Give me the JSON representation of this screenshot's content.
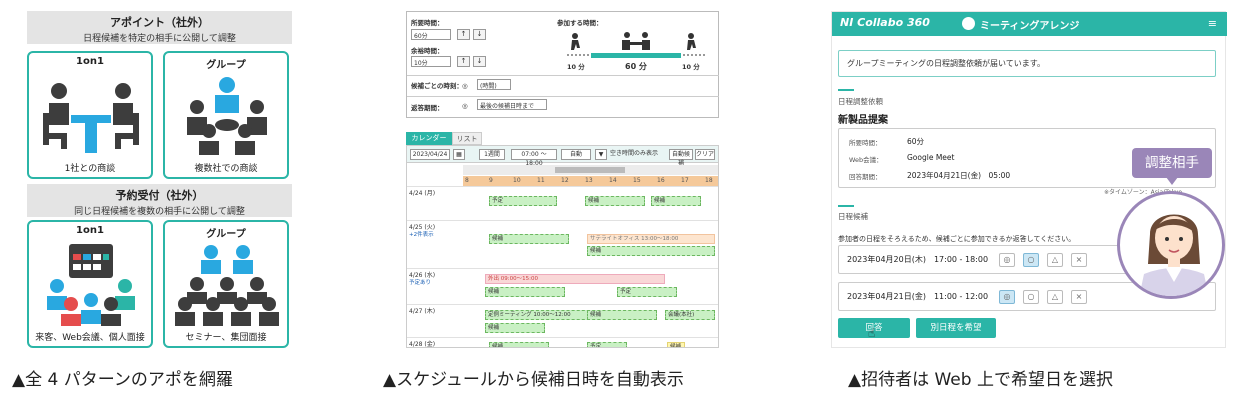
{
  "panel1": {
    "section_appointment": {
      "title": "アポイント（社外）",
      "subtitle": "日程候補を特定の相手に公開して調整"
    },
    "section_reservation": {
      "title": "予約受付（社外）",
      "subtitle": "同じ日程候補を複数の相手に公開して調整"
    },
    "cards": [
      {
        "title": "1on1",
        "caption": "1社との商談",
        "icon": "one-on-one-meeting-icon"
      },
      {
        "title": "グループ",
        "caption": "複数社での商談",
        "icon": "group-meeting-icon"
      },
      {
        "title": "1on1",
        "caption": "来客、Web会議、個人面接",
        "icon": "calendar-booking-icon"
      },
      {
        "title": "グループ",
        "caption": "セミナー、集団面接",
        "icon": "seminar-icon"
      }
    ],
    "colors": {
      "accent": "#2bb5a7",
      "figure": "#3d3d3d",
      "table": "#29a8e0"
    }
  },
  "panel2": {
    "form": {
      "required_time_label": "所要時間：",
      "required_time_value": "60分",
      "buffer_label": "余裕時間：",
      "buffer_value": "10分",
      "participants_label": "参加する時間：",
      "timeline_left": "10 分",
      "timeline_center": "60 分",
      "timeline_right": "10 分",
      "per_candidate_label": "候補ごとの時刻：",
      "per_candidate_value": "(時間)",
      "deadline_label": "返答期間：",
      "deadline_value": "最後の候補日時まで"
    },
    "tabs": [
      "カレンダー",
      "リスト"
    ],
    "toolbar": {
      "date": "2023/04/24",
      "range": "1週間",
      "time": "07:00 ～ 18:00",
      "autofill": "自動",
      "checkbox": "空き時間のみ表示",
      "btn_auto": "自動候補",
      "btn_clear": "クリア"
    },
    "hours": [
      "8",
      "9",
      "10",
      "11",
      "12",
      "13",
      "14",
      "15",
      "16",
      "17",
      "18"
    ],
    "days": [
      {
        "label": "4/24 (月)",
        "sub": ""
      },
      {
        "label": "4/25 (火)",
        "sub": "+2件表示"
      },
      {
        "label": "4/26 (水)",
        "sub": "予定あり"
      },
      {
        "label": "4/27 (木)",
        "sub": ""
      },
      {
        "label": "4/28 (金)",
        "sub": ""
      }
    ],
    "event_texts": {
      "candidate": "候補",
      "busy": "予定",
      "satellite": "サテライトオフィス 13:00～18:00",
      "outing": "外出 09:00～15:00",
      "meeting": "定例ミーティング 10:00～12:00",
      "company": "会議(本社)"
    }
  },
  "panel3": {
    "brand": "NI Collabo 360",
    "app_title": "ミーティングアレンジ",
    "notice": "グループミーティングの日程調整依頼が届いています。",
    "request_section": "日程調整依頼",
    "meeting_title": "新製品提案",
    "details": [
      {
        "label": "所要時間：",
        "value": "60分"
      },
      {
        "label": "Web会議：",
        "value": "Google Meet"
      },
      {
        "label": "回答期間：",
        "value": "2023年04月21日(金)　05:00"
      }
    ],
    "timezone": "※タイムゾーン：Asia/Tokyo",
    "candidates_section": "日程候補",
    "candidates_note": "参加者の日程をそろえるため、候補ごとに参加できるか返答してください。",
    "slots": [
      {
        "text": "2023年04月20日(木)　17:00 - 18:00",
        "options": [
          "◎",
          "○",
          "△",
          "×"
        ],
        "selected": 1
      },
      {
        "text": "2023年04月21日(金)　11:00 - 12:00",
        "options": [
          "◎",
          "○",
          "△",
          "×"
        ],
        "selected": 0
      }
    ],
    "btn_submit": "回答",
    "btn_other": "別日程を希望",
    "badge": "調整相手",
    "colors": {
      "accent": "#2bb5a7",
      "badge": "#9a86b8"
    }
  },
  "captions": [
    "▲全 4 パターンのアポを網羅",
    "▲スケジュールから候補日時を自動表示",
    "▲招待者は Web 上で希望日を選択"
  ]
}
